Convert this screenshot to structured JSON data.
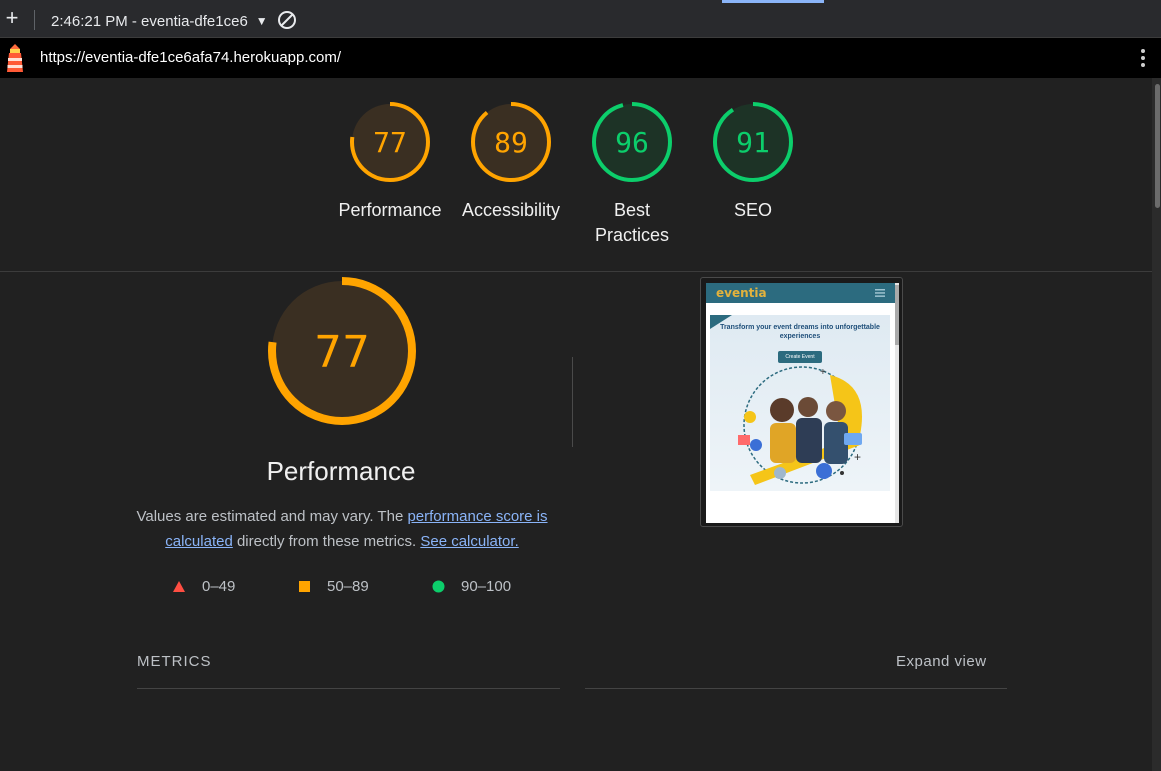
{
  "toolbar": {
    "report_selector": "2:46:21 PM - eventia-dfe1ce6",
    "new_report_icon": "plus-icon",
    "clear_icon": "block-icon"
  },
  "urlbar": {
    "url": "https://eventia-dfe1ce6afa74.herokuapp.com/",
    "lighthouse_icon": "lighthouse-icon",
    "menu_icon": "kebab-menu-icon"
  },
  "gauges": [
    {
      "label": "Performance",
      "score": 77,
      "color": "#ffa400"
    },
    {
      "label": "Accessibility",
      "score": 89,
      "color": "#ffa400"
    },
    {
      "label": "Best Practices",
      "score": 96,
      "color": "#0cce6b"
    },
    {
      "label": "SEO",
      "score": 91,
      "color": "#0cce6b"
    }
  ],
  "performance": {
    "score": 77,
    "title": "Performance",
    "desc_prefix": "Values are estimated and may vary. The ",
    "desc_link1": "performance score is calculated",
    "desc_middle": " directly from these metrics. ",
    "desc_link2": "See calculator.",
    "color": "#ffa400"
  },
  "legend": [
    {
      "range": "0–49",
      "shape": "triangle",
      "color": "#ff4e42"
    },
    {
      "range": "50–89",
      "shape": "square",
      "color": "#ffa400"
    },
    {
      "range": "90–100",
      "shape": "circle",
      "color": "#0cce6b"
    }
  ],
  "screenshot": {
    "brand": "eventia",
    "hero_title": "Transform your event dreams into unforgettable experiences",
    "cta": "Create Event"
  },
  "metrics": {
    "label": "METRICS",
    "expand": "Expand view"
  },
  "colors": {
    "pass": "#0cce6b",
    "average": "#ffa400",
    "fail": "#ff4e42",
    "link": "#8ab4f8"
  }
}
